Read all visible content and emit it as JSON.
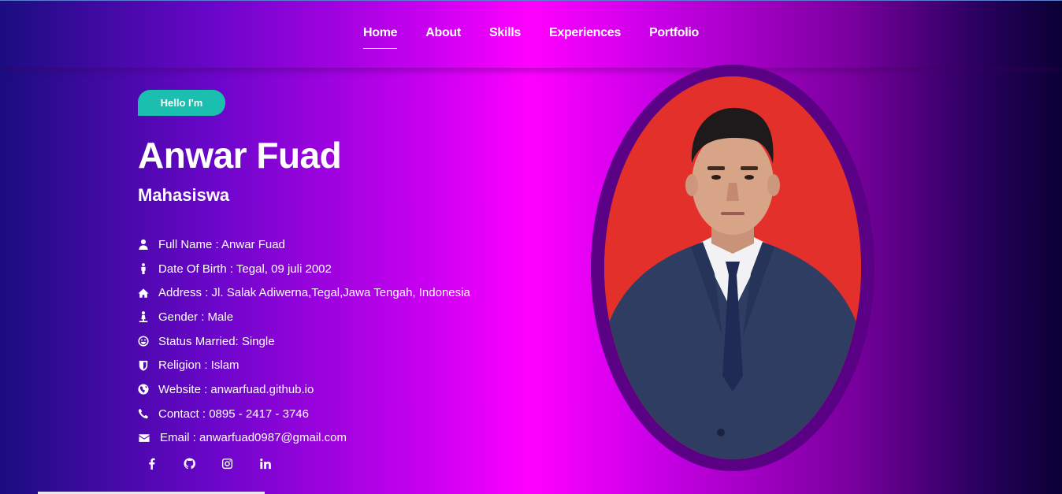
{
  "nav": {
    "items": [
      "Home",
      "About",
      "Skills",
      "Experiences",
      "Portfolio"
    ],
    "active": "Home"
  },
  "hero": {
    "badge": "Hello I'm",
    "name": "Anwar Fuad",
    "role": "Mahasiswa",
    "info": [
      {
        "icon": "user-icon",
        "text": "Full Name : Anwar Fuad"
      },
      {
        "icon": "male-icon",
        "text": "Date Of Birth : Tegal, 09 juli 2002"
      },
      {
        "icon": "home-icon",
        "text": "Address : Jl. Salak Adiwerna,Tegal,Jawa Tengah, Indonesia"
      },
      {
        "icon": "gender-icon",
        "text": "Gender : Male"
      },
      {
        "icon": "smile-icon",
        "text": "Status Married: Single"
      },
      {
        "icon": "shield-icon",
        "text": "Religion : Islam"
      },
      {
        "icon": "globe-icon",
        "text": "Website : anwarfuad.github.io"
      },
      {
        "icon": "phone-icon",
        "text": "Contact : 0895 - 2417 - 3746"
      },
      {
        "icon": "envelope-icon",
        "text": "Email : anwarfuad0987@gmail.com"
      }
    ]
  },
  "socials": [
    "facebook-icon",
    "github-icon",
    "instagram-icon",
    "linkedin-icon"
  ],
  "colors": {
    "badge": "#1bbfb0",
    "photo_frame": "#5a0084",
    "photo_background": "#e3302a"
  }
}
